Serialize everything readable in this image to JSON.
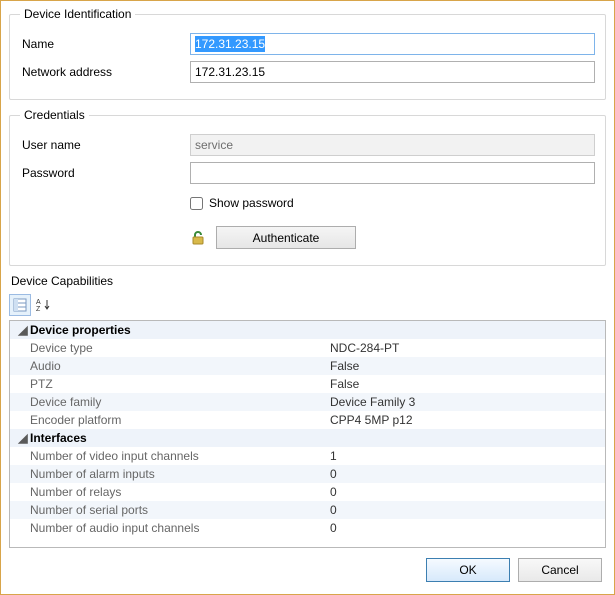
{
  "deviceIdentification": {
    "legend": "Device Identification",
    "nameLabel": "Name",
    "nameValue": "172.31.23.15",
    "addressLabel": "Network address",
    "addressValue": "172.31.23.15"
  },
  "credentials": {
    "legend": "Credentials",
    "userLabel": "User name",
    "userValue": "service",
    "passwordLabel": "Password",
    "passwordValue": "",
    "showPasswordLabel": "Show password",
    "showPasswordChecked": false,
    "authenticateLabel": "Authenticate"
  },
  "capabilities": {
    "title": "Device Capabilities",
    "categories": [
      {
        "name": "Device properties",
        "rows": [
          {
            "key": "Device type",
            "value": "NDC-284-PT"
          },
          {
            "key": "Audio",
            "value": "False"
          },
          {
            "key": "PTZ",
            "value": "False"
          },
          {
            "key": "Device family",
            "value": "Device Family 3"
          },
          {
            "key": "Encoder platform",
            "value": "CPP4 5MP p12"
          }
        ]
      },
      {
        "name": "Interfaces",
        "rows": [
          {
            "key": "Number of video input channels",
            "value": "1"
          },
          {
            "key": "Number of alarm inputs",
            "value": "0"
          },
          {
            "key": "Number of relays",
            "value": "0"
          },
          {
            "key": "Number of serial ports",
            "value": "0"
          },
          {
            "key": "Number of audio input channels",
            "value": "0"
          }
        ]
      }
    ]
  },
  "buttons": {
    "ok": "OK",
    "cancel": "Cancel"
  }
}
